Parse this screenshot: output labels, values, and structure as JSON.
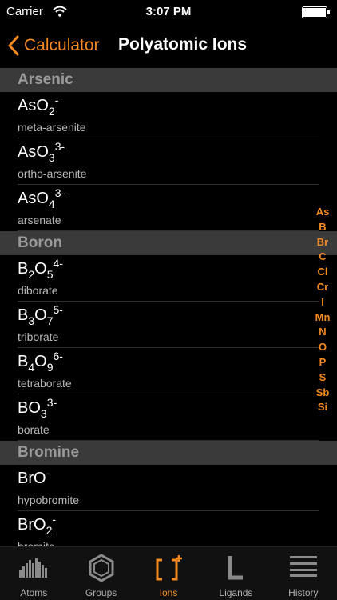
{
  "status": {
    "carrier": "Carrier",
    "time": "3:07 PM"
  },
  "nav": {
    "back_label": "Calculator",
    "title": "Polyatomic Ions"
  },
  "sections": [
    {
      "title": "Arsenic",
      "rows": [
        {
          "parts": [
            [
              "As",
              ""
            ],
            [
              "O",
              ""
            ],
            [
              "2",
              "sub"
            ],
            [
              "-",
              "sup"
            ]
          ],
          "name": "meta-arsenite"
        },
        {
          "parts": [
            [
              "As",
              ""
            ],
            [
              "O",
              ""
            ],
            [
              "3",
              "sub"
            ],
            [
              "3-",
              "sup"
            ]
          ],
          "name": "ortho-arsenite"
        },
        {
          "parts": [
            [
              "As",
              ""
            ],
            [
              "O",
              ""
            ],
            [
              "4",
              "sub"
            ],
            [
              "3-",
              "sup"
            ]
          ],
          "name": "arsenate"
        }
      ]
    },
    {
      "title": "Boron",
      "rows": [
        {
          "parts": [
            [
              "B",
              ""
            ],
            [
              "2",
              "sub"
            ],
            [
              "O",
              ""
            ],
            [
              "5",
              "sub"
            ],
            [
              "4-",
              "sup"
            ]
          ],
          "name": "diborate"
        },
        {
          "parts": [
            [
              "B",
              ""
            ],
            [
              "3",
              "sub"
            ],
            [
              "O",
              ""
            ],
            [
              "7",
              "sub"
            ],
            [
              "5-",
              "sup"
            ]
          ],
          "name": "triborate"
        },
        {
          "parts": [
            [
              "B",
              ""
            ],
            [
              "4",
              "sub"
            ],
            [
              "O",
              ""
            ],
            [
              "9",
              "sub"
            ],
            [
              "6-",
              "sup"
            ]
          ],
          "name": "tetraborate"
        },
        {
          "parts": [
            [
              "B",
              ""
            ],
            [
              "O",
              ""
            ],
            [
              "3",
              "sub"
            ],
            [
              "3-",
              "sup"
            ]
          ],
          "name": "borate"
        }
      ]
    },
    {
      "title": "Bromine",
      "rows": [
        {
          "parts": [
            [
              "Br",
              ""
            ],
            [
              "O",
              ""
            ],
            [
              "-",
              "sup"
            ]
          ],
          "name": "hypobromite"
        },
        {
          "parts": [
            [
              "Br",
              ""
            ],
            [
              "O",
              ""
            ],
            [
              "2",
              "sub"
            ],
            [
              "-",
              "sup"
            ]
          ],
          "name": "bromite"
        }
      ]
    }
  ],
  "index": [
    "As",
    "B",
    "Br",
    "C",
    "Cl",
    "Cr",
    "I",
    "Mn",
    "N",
    "O",
    "P",
    "S",
    "Sb",
    "Si"
  ],
  "tabs": [
    {
      "label": "Atoms",
      "icon": "atoms-bars-icon",
      "active": false
    },
    {
      "label": "Groups",
      "icon": "hexagon-icon",
      "active": false
    },
    {
      "label": "Ions",
      "icon": "brackets-plus-icon",
      "active": true
    },
    {
      "label": "Ligands",
      "icon": "ligand-L-icon",
      "active": false
    },
    {
      "label": "History",
      "icon": "history-lines-icon",
      "active": false
    }
  ],
  "colors": {
    "accent": "#f58a1f",
    "section_bg": "#3a3a3a",
    "background": "#000000"
  }
}
